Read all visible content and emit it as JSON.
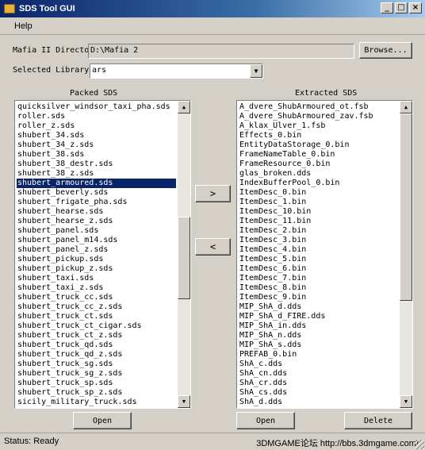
{
  "window": {
    "title": "SDS Tool GUI"
  },
  "menu": {
    "help": "Help"
  },
  "mafia_dir": {
    "label": "Mafia II Directo",
    "value": "D:\\Mafia 2",
    "browse_label": "Browse..."
  },
  "library": {
    "label": "Selected Library",
    "value": "ars"
  },
  "packed": {
    "title": "Packed SDS",
    "items": [
      "quicksilver_windsor_taxi_pha.sds",
      "roller.sds",
      "roller_z.sds",
      "shubert_34.sds",
      "shubert_34_z.sds",
      "shubert_38.sds",
      "shubert_38_destr.sds",
      "shubert_38_z.sds",
      "shubert_armoured.sds",
      "shubert_beverly.sds",
      "shubert_frigate_pha.sds",
      "shubert_hearse.sds",
      "shubert_hearse_z.sds",
      "shubert_panel.sds",
      "shubert_panel_m14.sds",
      "shubert_panel_z.sds",
      "shubert_pickup.sds",
      "shubert_pickup_z.sds",
      "shubert_taxi.sds",
      "shubert_taxi_z.sds",
      "shubert_truck_cc.sds",
      "shubert_truck_cc_z.sds",
      "shubert_truck_ct.sds",
      "shubert_truck_ct_cigar.sds",
      "shubert_truck_ct_z.sds",
      "shubert_truck_qd.sds",
      "shubert_truck_qd_z.sds",
      "shubert_truck_sg.sds",
      "shubert_truck_sg_z.sds",
      "shubert_truck_sp.sds",
      "shubert_truck_sp_z.sds",
      "sicily_military_truck.sds"
    ],
    "selected_index": 8,
    "open_label": "Open"
  },
  "extracted": {
    "title": "Extracted SDS",
    "items": [
      "A_dvere_ShubArmoured_ot.fsb",
      "A_dvere_ShubArmoured_zav.fsb",
      "A_klax_Ulver_1.fsb",
      "Effects_0.bin",
      "EntityDataStorage_0.bin",
      "FrameNameTable_0.bin",
      "FrameResource_0.bin",
      "glas_broken.dds",
      "IndexBufferPool_0.bin",
      "ItemDesc_0.bin",
      "ItemDesc_1.bin",
      "ItemDesc_10.bin",
      "ItemDesc_11.bin",
      "ItemDesc_2.bin",
      "ItemDesc_3.bin",
      "ItemDesc_4.bin",
      "ItemDesc_5.bin",
      "ItemDesc_6.bin",
      "ItemDesc_7.bin",
      "ItemDesc_8.bin",
      "ItemDesc_9.bin",
      "MIP_ShA_d.dds",
      "MIP_ShA_d_FIRE.dds",
      "MIP_ShA_in.dds",
      "MIP_ShA_n.dds",
      "MIP_ShA_s.dds",
      "PREFAB_0.bin",
      "ShA_c.dds",
      "ShA_cn.dds",
      "ShA_cr.dds",
      "ShA_cs.dds",
      "ShA_d.dds"
    ],
    "open_label": "Open",
    "delete_label": "Delete"
  },
  "transfer": {
    "right_label": ">",
    "left_label": "<"
  },
  "status": {
    "text": "Status: Ready",
    "watermark": "3DMGAME论坛 http://bbs.3dmgame.com/"
  }
}
